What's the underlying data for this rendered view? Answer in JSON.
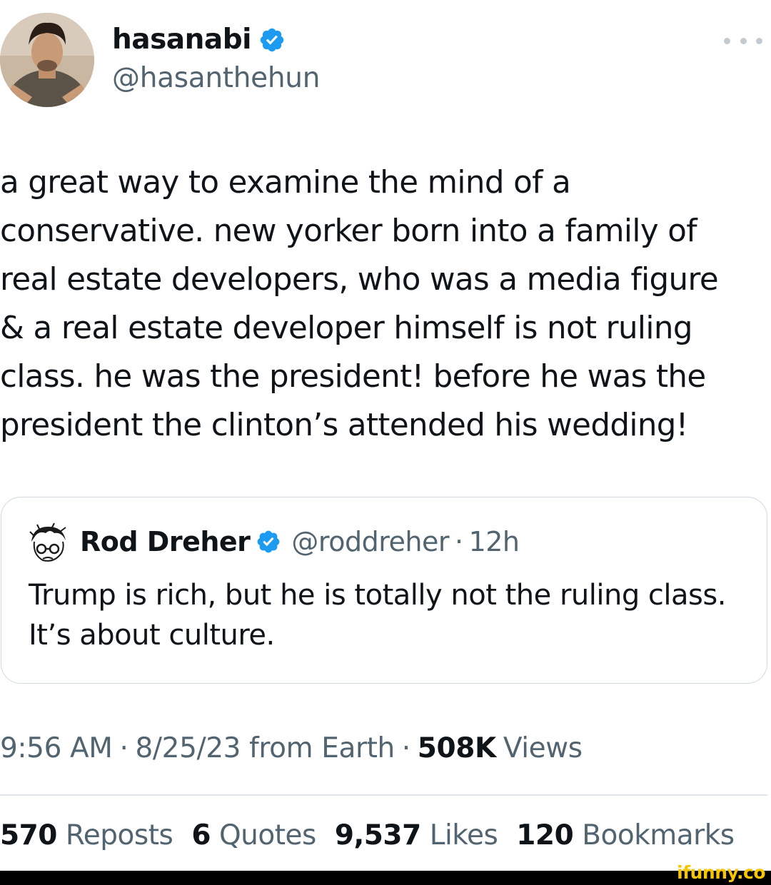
{
  "author": {
    "display_name": "hasanabi",
    "handle": "@hasanthehun",
    "verified_icon": "verified-badge-icon"
  },
  "tweet": {
    "text": "a great way to examine the mind of a\nconservative. new yorker born into a family of\nreal estate developers, who was a media figure\n& a real estate developer himself is not ruling\nclass. he was the president! before he was the\npresident the clinton’s attended his wedding!"
  },
  "quoted_tweet": {
    "display_name": "Rod Dreher",
    "handle": "@roddreher",
    "separator": "·",
    "time": "12h",
    "text": "Trump is rich, but he is totally not the ruling class.\nIt’s about culture."
  },
  "meta": {
    "time": "9:56 AM",
    "separator": "·",
    "date_source": "8/25/23 from Earth",
    "views_count": "508K",
    "views_label": "Views"
  },
  "stats": [
    {
      "count": "570",
      "label": "Reposts"
    },
    {
      "count": "6",
      "label": "Quotes"
    },
    {
      "count": "9,537",
      "label": "Likes"
    },
    {
      "count": "120",
      "label": "Bookmarks"
    }
  ],
  "watermark": "ifunny.co",
  "colors": {
    "text_primary": "#0f1419",
    "text_secondary": "#536471",
    "verified_blue": "#1d9bf0",
    "border": "#cfd9de",
    "watermark": "#f7c600"
  }
}
